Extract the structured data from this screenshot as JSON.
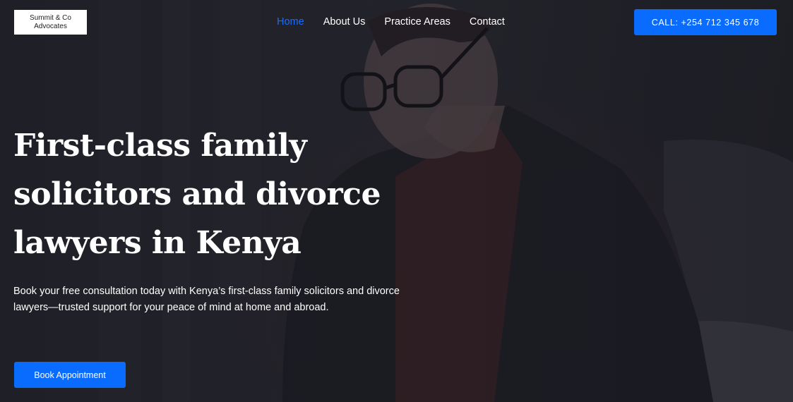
{
  "brand": {
    "line1": "Summit & Co",
    "line2": "Advocates"
  },
  "nav": {
    "items": [
      {
        "label": "Home",
        "active": true
      },
      {
        "label": "About Us",
        "active": false
      },
      {
        "label": "Practice Areas",
        "active": false
      },
      {
        "label": "Contact",
        "active": false
      }
    ]
  },
  "header": {
    "call_label": "CALL: +254 712 345 678"
  },
  "hero": {
    "headline": "First-class family solicitors and divorce lawyers in Kenya",
    "subtext": "Book your free consultation today with Kenya’s first-class family solicitors and divorce lawyers—trusted support for your peace of mind at home and abroad.",
    "cta_label": "Book Appointment"
  },
  "colors": {
    "accent": "#0a6cff",
    "active_nav": "#1a6cff",
    "background": "#26262d"
  }
}
